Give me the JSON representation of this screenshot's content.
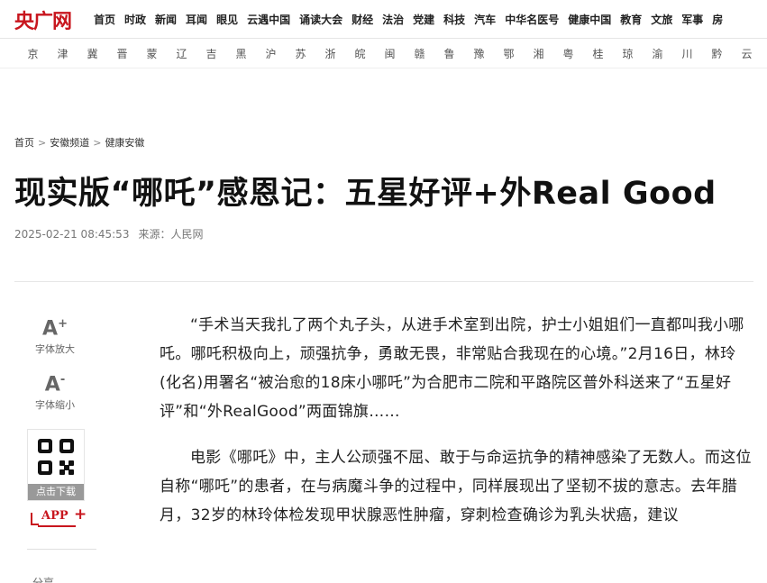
{
  "site": {
    "logo": "央广网"
  },
  "nav": [
    "首页",
    "时政",
    "新闻",
    "耳闻",
    "眼见",
    "云遇中国",
    "诵读大会",
    "财经",
    "法治",
    "党建",
    "科技",
    "汽车",
    "中华名医号",
    "健康中国",
    "教育",
    "文旅",
    "军事",
    "房"
  ],
  "provinces": [
    "京",
    "津",
    "冀",
    "晋",
    "蒙",
    "辽",
    "吉",
    "黑",
    "沪",
    "苏",
    "浙",
    "皖",
    "闽",
    "赣",
    "鲁",
    "豫",
    "鄂",
    "湘",
    "粤",
    "桂",
    "琼",
    "渝",
    "川",
    "黔",
    "云"
  ],
  "breadcrumb": [
    "首页",
    "安徽频道",
    "健康安徽"
  ],
  "breadcrumb_sep": ">",
  "article": {
    "title": "现实版“哪吒”感恩记：五星好评+外Real Good",
    "datetime": "2025-02-21 08:45:53",
    "source": "来源：人民网",
    "paragraphs": [
      "“手术当天我扎了两个丸子头，从进手术室到出院，护士小姐姐们一直都叫我小哪吒。哪吒积极向上，顽强抗争，勇敢无畏，非常贴合我现在的心境。”2月16日，林玲(化名)用署名“被治愈的18床小哪吒”为合肥市二院和平路院区普外科送来了“五星好评”和“外RealGood”两面锦旗……",
      "电影《哪吒》中，主人公顽强不屈、敢于与命运抗争的精神感染了无数人。而这位自称“哪吒”的患者，在与病魔斗争的过程中，同样展现出了坚韧不拔的意志。去年腊月，32岁的林玲体检发现甲状腺恶性肿瘤，穿刺检查确诊为乳头状癌，建议"
    ]
  },
  "tools": {
    "font_up_glyph": "A",
    "font_up_mark": "+",
    "font_up_label": "字体放大",
    "font_down_glyph": "A",
    "font_down_mark": "-",
    "font_down_label": "字体缩小",
    "qr_caption": "点击下载",
    "app_label": "APP",
    "app_plus": "+",
    "share_label": "分享"
  },
  "colors": {
    "brand": "#c8161e"
  }
}
